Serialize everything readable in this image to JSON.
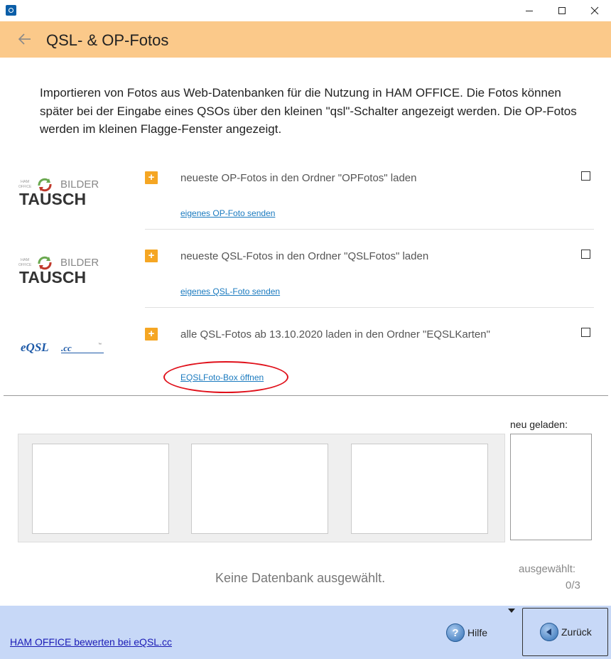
{
  "window": {
    "title": "",
    "controls": [
      "minimize-icon",
      "maximize-icon",
      "close-icon"
    ]
  },
  "header": {
    "title": "QSL- & OP-Fotos",
    "back_icon": "back-arrow-icon",
    "background": "#fbc98a"
  },
  "intro": "Importieren von Fotos aus Web-Datenbanken für die Nutzung in HAM OFFICE. Die Fotos können später bei der Eingabe eines QSOs über den kleinen \"qsl\"-Schalter angezeigt werden. Die OP-Fotos werden im kleinen Flagge-Fenster angezeigt.",
  "sources": [
    {
      "logo": {
        "small_top": "HAM",
        "small_bottom": "OFFICE",
        "word_top": "BILDER",
        "word_bottom": "TAUSCH"
      },
      "expand_label": "+",
      "text": "neueste OP-Fotos in den Ordner \"OPFotos\" laden",
      "link": "eigenes OP-Foto senden",
      "checked": false
    },
    {
      "logo": {
        "small_top": "HAM",
        "small_bottom": "OFFICE",
        "word_top": "BILDER",
        "word_bottom": "TAUSCH"
      },
      "expand_label": "+",
      "text": "neueste QSL-Fotos in den Ordner \"QSLFotos\" laden",
      "link": "eigenes QSL-Foto senden",
      "checked": false
    },
    {
      "logo": {
        "word": "eQSL",
        "suffix": ".cc",
        "tm": "™"
      },
      "expand_label": "+",
      "text": "alle QSL-Fotos ab 13.10.2020 laden in den Ordner \"EQSLKarten\"",
      "link": "EQSLFoto-Box öffnen",
      "checked": false
    }
  ],
  "preview": {
    "new_label": "neu geladen:",
    "status": "Keine Datenbank ausgewählt.",
    "selected_label": "ausgewählt:",
    "selected_count": "0/3"
  },
  "footer": {
    "rate_link": "HAM OFFICE bewerten bei eQSL.cc",
    "help_label": "Hilfe",
    "help_icon": "help-icon",
    "back_label": "Zurück",
    "back_icon": "back-circle-icon",
    "background": "#c7d8f7"
  },
  "colors": {
    "accent": "#f5a623",
    "link": "#1a7abf",
    "highlight": "#e0101a"
  }
}
